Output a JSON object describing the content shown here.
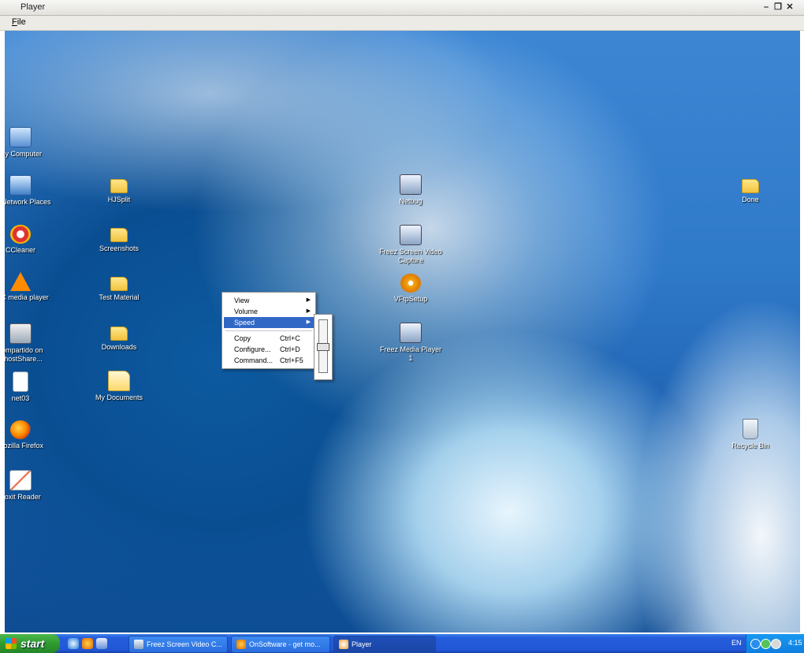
{
  "window": {
    "title": "Player",
    "controls": {
      "minimize": "–",
      "maximize": "❐",
      "close": "✕"
    }
  },
  "menubar": {
    "file": "File"
  },
  "desktop": {
    "icons": [
      {
        "label": "My Computer",
        "icon": "my-computer-icon"
      },
      {
        "label": "My Network Places",
        "icon": "network-places-icon"
      },
      {
        "label": "CCleaner",
        "icon": "ccleaner-icon"
      },
      {
        "label": "VLC media player",
        "icon": "vlc-icon"
      },
      {
        "label": "compartido on GhostShare...",
        "icon": "network-share-icon"
      },
      {
        "label": "net03",
        "icon": "document-icon"
      },
      {
        "label": "Mozilla Firefox",
        "icon": "firefox-icon"
      },
      {
        "label": "Foxit Reader",
        "icon": "foxit-icon"
      },
      {
        "label": "HJSplit",
        "icon": "folder-icon"
      },
      {
        "label": "Screenshots",
        "icon": "folder-icon"
      },
      {
        "label": "Test Material",
        "icon": "folder-icon"
      },
      {
        "label": "Downloads",
        "icon": "folder-icon"
      },
      {
        "label": "My Documents",
        "icon": "my-documents-icon"
      },
      {
        "label": "Netbug",
        "icon": "app-icon"
      },
      {
        "label": "Freez Screen Video Capture",
        "icon": "app-icon"
      },
      {
        "label": "VFtpSetup",
        "icon": "installer-icon"
      },
      {
        "label": "Freez Media Player 1",
        "icon": "media-player-icon"
      },
      {
        "label": "Done",
        "icon": "folder-icon"
      },
      {
        "label": "Recycle Bin",
        "icon": "recycle-bin-icon"
      }
    ]
  },
  "context_menu": {
    "items": [
      {
        "label": "View",
        "submenu": true
      },
      {
        "label": "Volume",
        "submenu": true
      },
      {
        "label": "Speed",
        "submenu": true,
        "selected": true
      },
      {
        "label": "Copy",
        "shortcut": "Ctrl+C"
      },
      {
        "label": "Configure...",
        "shortcut": "Ctrl+D"
      },
      {
        "label": "Command...",
        "shortcut": "Ctrl+F5"
      }
    ],
    "speed_slider": {
      "level": 0.5
    }
  },
  "taskbar": {
    "start": "start",
    "tasks": [
      {
        "label": "Freez Screen Video C...",
        "icon": "app-icon"
      },
      {
        "label": "OnSoftware - get mo...",
        "icon": "firefox-icon"
      },
      {
        "label": "Player",
        "icon": "player-icon",
        "active": true
      }
    ],
    "language": "EN",
    "clock": "4:15"
  },
  "colors": {
    "menu_highlight": "#3168c6",
    "taskbar": "#245ddb",
    "start_button": "#2f9a2f"
  }
}
